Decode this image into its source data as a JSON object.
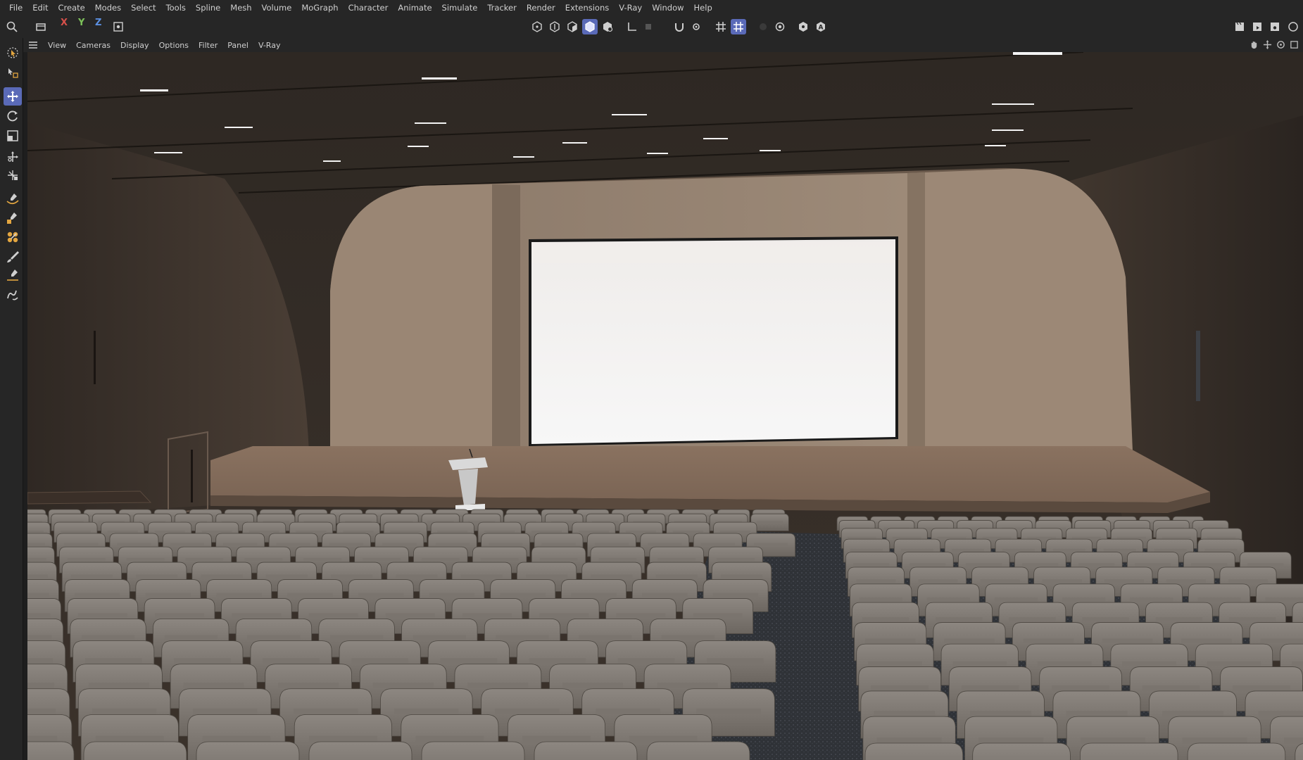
{
  "menubar": {
    "items": [
      "File",
      "Edit",
      "Create",
      "Modes",
      "Select",
      "Tools",
      "Spline",
      "Mesh",
      "Volume",
      "MoGraph",
      "Character",
      "Animate",
      "Simulate",
      "Tracker",
      "Render",
      "Extensions",
      "V-Ray",
      "Window",
      "Help"
    ]
  },
  "toolbar": {
    "axis_x": "X",
    "axis_y": "Y",
    "axis_z": "Z"
  },
  "viewport_menu": {
    "items": [
      "View",
      "Cameras",
      "Display",
      "Options",
      "Filter",
      "Panel",
      "V-Ray"
    ]
  },
  "colors": {
    "accent": "#5a6ab8",
    "ui_bg": "#262626",
    "axis_x": "#d6504a",
    "axis_y": "#7dc25a",
    "axis_z": "#5b8fe0"
  }
}
